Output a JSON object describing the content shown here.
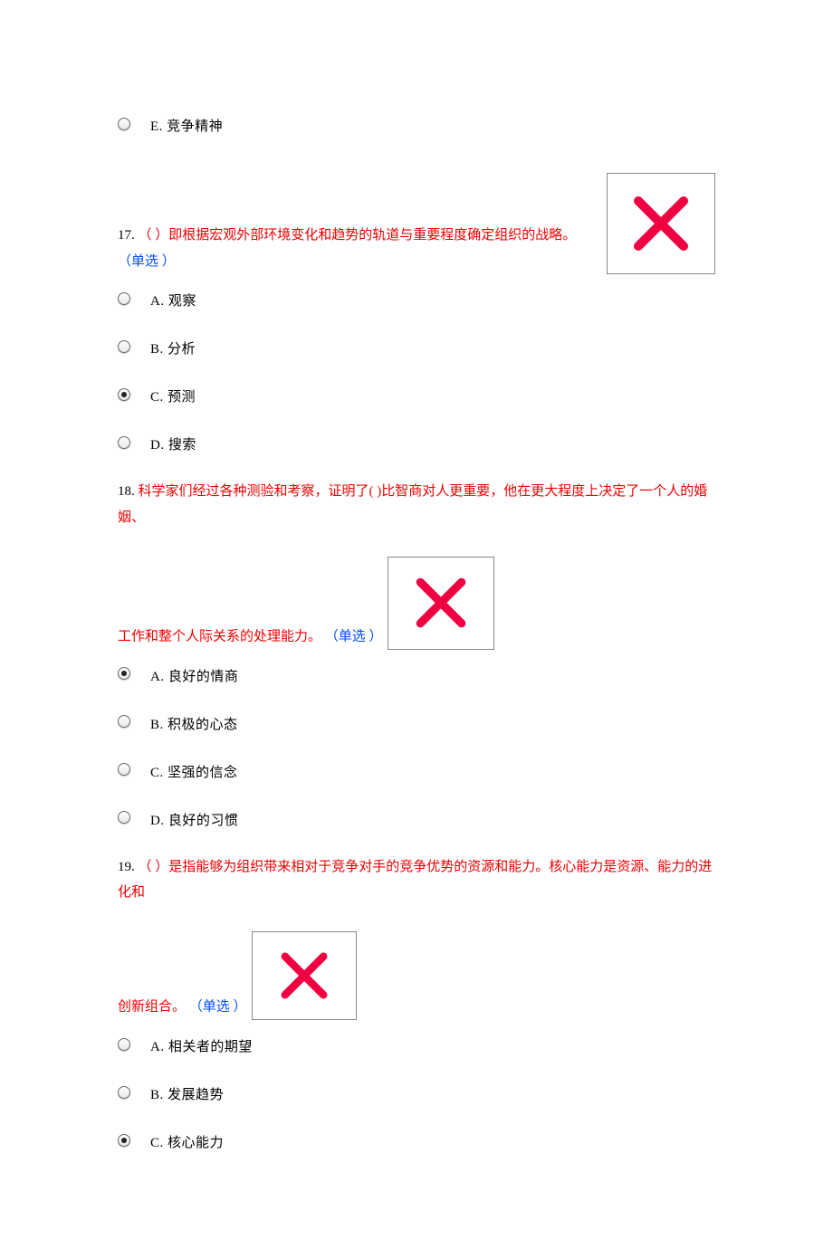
{
  "orphan_option": {
    "label": "E. 竞争精神"
  },
  "q17": {
    "num": "17.",
    "stem_red": "（ ）即根据宏观外部环境变化和趋势的轨道与重要程度确定组织的战略。 ",
    "type_blue": "（单选 ）",
    "options": [
      {
        "label": "A. 观察",
        "selected": false
      },
      {
        "label": "B. 分析",
        "selected": false
      },
      {
        "label": "C. 预测",
        "selected": true
      },
      {
        "label": "D. 搜索",
        "selected": false
      }
    ]
  },
  "q18": {
    "num": "18.",
    "stem_red_1": "科学家们经过各种测验和考察，证明了( )比智商对人更重要，他在更大程度上决定了一个人的婚姻、",
    "stem_red_2": "工作和整个人际关系的处理能力。 ",
    "type_blue": "（单选 ）",
    "options": [
      {
        "label": "A. 良好的情商",
        "selected": true
      },
      {
        "label": "B. 积极的心态",
        "selected": false
      },
      {
        "label": "C. 坚强的信念",
        "selected": false
      },
      {
        "label": "D. 良好的习惯",
        "selected": false
      }
    ]
  },
  "q19": {
    "num": "19.",
    "stem_red_1": "（ ）是指能够为组织带来相对于竞争对手的竞争优势的资源和能力。核心能力是资源、能力的进化和",
    "stem_red_2": "创新组合。 ",
    "type_blue": "（单选 ）",
    "options": [
      {
        "label": "A. 相关者的期望",
        "selected": false
      },
      {
        "label": "B. 发展趋势",
        "selected": false
      },
      {
        "label": "C. 核心能力",
        "selected": true
      }
    ]
  }
}
